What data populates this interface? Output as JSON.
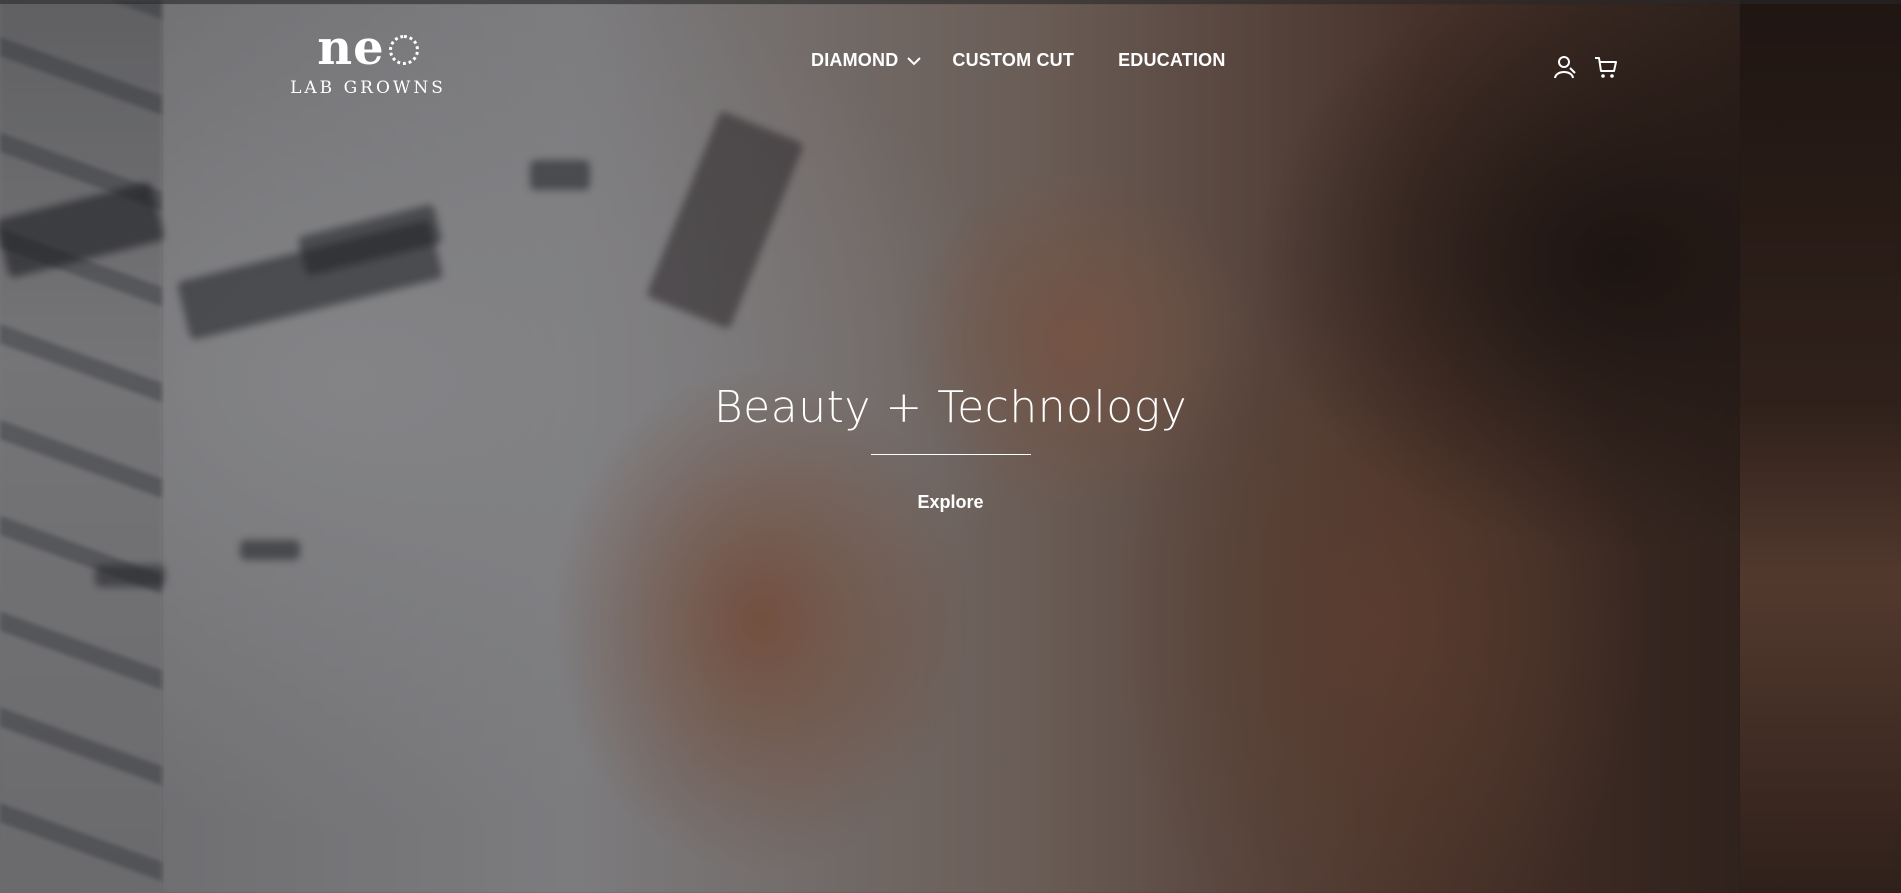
{
  "brand": {
    "logo_word": "ne",
    "logo_sub": "LAB GROWNS"
  },
  "nav": {
    "items": [
      {
        "label": "DIAMOND",
        "has_dropdown": true
      },
      {
        "label": "CUSTOM CUT",
        "has_dropdown": false
      },
      {
        "label": "EDUCATION",
        "has_dropdown": false
      }
    ]
  },
  "header_icons": [
    "account-icon",
    "cart-icon"
  ],
  "hero": {
    "title": "Beauty + Technology",
    "cta_label": "Explore"
  },
  "colors": {
    "text": "#ffffff",
    "overlay": "#14100e"
  }
}
